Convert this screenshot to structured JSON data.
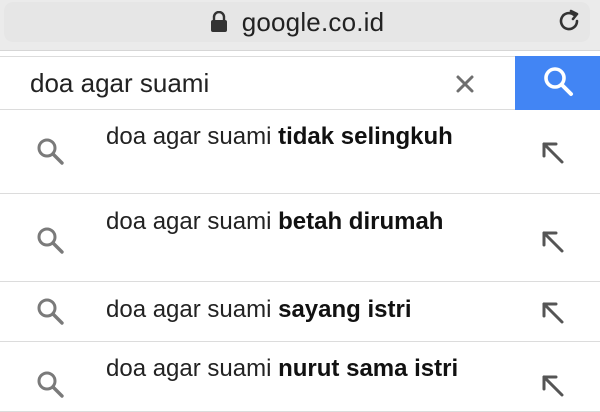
{
  "browser": {
    "url": "google.co.id",
    "icons": [
      "lock-icon",
      "reload-icon"
    ]
  },
  "search": {
    "query": "doa agar suami",
    "icons": [
      "clear-icon",
      "search-icon"
    ]
  },
  "suggestions": [
    {
      "prefix": "doa agar suami ",
      "bold": "tidak selingkuh"
    },
    {
      "prefix": "doa agar suami ",
      "bold": "betah dirumah"
    },
    {
      "prefix": "doa agar suami ",
      "bold": "sayang istri"
    },
    {
      "prefix": "doa agar suami ",
      "bold": "nurut sama istri"
    }
  ],
  "colors": {
    "accent": "#4285f4",
    "bar": "#ebebeb",
    "icon_gray": "#7a7a7a"
  }
}
